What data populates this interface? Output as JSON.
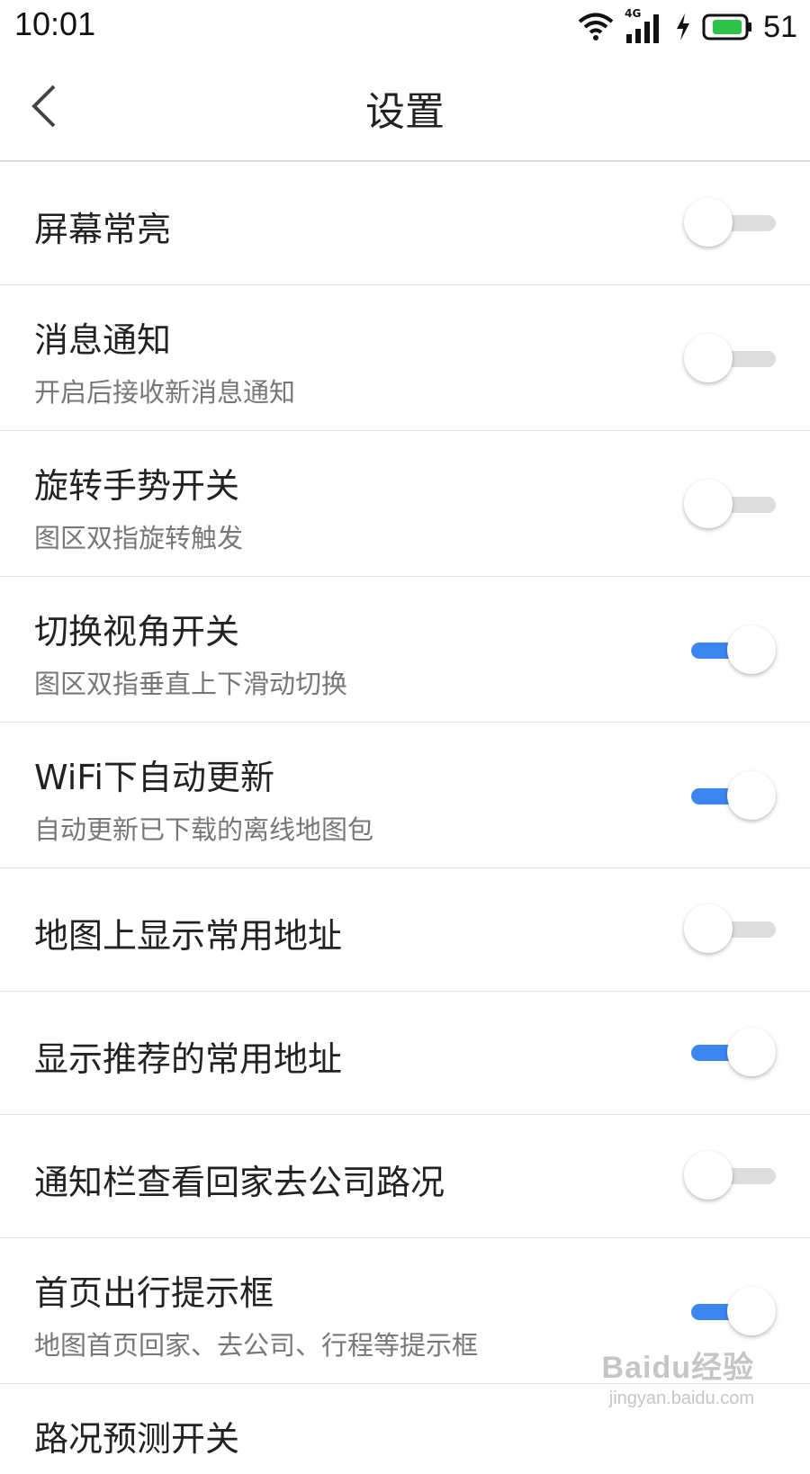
{
  "status_bar": {
    "time": "10:01",
    "network": "4G",
    "battery": "51",
    "icons": [
      "wifi-icon",
      "signal-icon",
      "charging-icon",
      "battery-icon"
    ]
  },
  "header": {
    "title": "设置",
    "back_icon": "chevron-left-icon"
  },
  "colors": {
    "accent": "#3b86f0",
    "toggle_off": "#dddddd",
    "divider": "#e2e2e2"
  },
  "settings": [
    {
      "title": "屏幕常亮",
      "subtitle": "",
      "on": false
    },
    {
      "title": "消息通知",
      "subtitle": "开启后接收新消息通知",
      "on": false
    },
    {
      "title": "旋转手势开关",
      "subtitle": "图区双指旋转触发",
      "on": false
    },
    {
      "title": "切换视角开关",
      "subtitle": "图区双指垂直上下滑动切换",
      "on": true
    },
    {
      "title": "WiFi下自动更新",
      "subtitle": "自动更新已下载的离线地图包",
      "on": true
    },
    {
      "title": "地图上显示常用地址",
      "subtitle": "",
      "on": false
    },
    {
      "title": "显示推荐的常用地址",
      "subtitle": "",
      "on": true
    },
    {
      "title": "通知栏查看回家去公司路况",
      "subtitle": "",
      "on": false
    },
    {
      "title": "首页出行提示框",
      "subtitle": "地图首页回家、去公司、行程等提示框",
      "on": true
    },
    {
      "title": "路况预测开关",
      "subtitle": "",
      "on": false
    }
  ],
  "watermark": {
    "main": "Baidu经验",
    "sub": "jingyan.baidu.com"
  }
}
